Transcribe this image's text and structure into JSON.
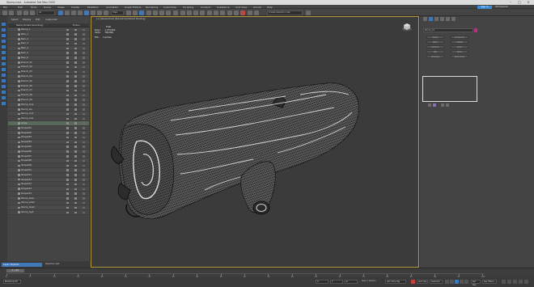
{
  "window": {
    "title": "Stump.max - Autodesk 3ds Max 2020"
  },
  "menu": [
    "File",
    "Edit",
    "Tools",
    "Group",
    "Views",
    "Create",
    "Modifiers",
    "Animation",
    "Graph Editors",
    "Rendering",
    "Customize",
    "Scripting",
    "Content",
    "Substance",
    "Civil View",
    "Arnold",
    "Help"
  ],
  "signin": "Sign In",
  "workspace": "Workspaces:",
  "toolbar": {
    "selection_set": "Create Selection Set",
    "view": "View"
  },
  "left_tabs": [
    "Select",
    "Display",
    "Edit",
    "Customize"
  ],
  "scene_header": {
    "col1": "Name (Sorted Ascending)",
    "col2": "Frozen"
  },
  "scene_rows": [
    "Stump_1",
    "Bark_1",
    "Bark_2",
    "Bark_3",
    "Bark_4",
    "Bark_5",
    "Bark_6",
    "Branch_01",
    "Branch_02",
    "Branch_03",
    "Branch_04",
    "Branch_05",
    "Branch_06",
    "Branch_07",
    "Branch_08",
    "Branch_09",
    "Stump_hole",
    "Stump_top",
    "Stump_root",
    "Stump_side",
    "Group",
    "Shape001",
    "Shape002",
    "Shape003",
    "Shape004",
    "Shape005",
    "Shape006",
    "Shape007",
    "Shape008",
    "Shape009",
    "Shape010",
    "Shape011",
    "Shape012",
    "Shape013",
    "Shape014",
    "Shape015",
    "Stump_base",
    "Stump_side2",
    "Stump_mesh",
    "Stump_high"
  ],
  "viewport": {
    "label": "[+] [Perspective] [Standard] [Default Shading]",
    "stats": {
      "title": "Total",
      "polys_label": "Polys:",
      "polys_value": "1,374,504",
      "verts_label": "Verts:",
      "verts_value": "700,864",
      "fps_label": "FPS:",
      "fps_value": "Inactive"
    }
  },
  "right_panel": {
    "object_name": "Stump_01",
    "buttons": [
      "Shape",
      "Compound",
      "Patch",
      "NURBS",
      "Particles",
      "Doors",
      "AEC",
      "Stairs",
      "Windows",
      "Point Cloud"
    ]
  },
  "status": {
    "layer": "Layer: Explorer",
    "selection": "Selection Set:"
  },
  "timeline": {
    "frame": "0 / 100",
    "ticks": [
      "0",
      "5",
      "10",
      "15",
      "20",
      "25",
      "30",
      "35",
      "40",
      "45",
      "50",
      "55",
      "60",
      "65",
      "70",
      "75",
      "80",
      "85",
      "90",
      "95",
      "100"
    ]
  },
  "bottom": {
    "script": "MAXScript Mi",
    "x": "X:",
    "y": "Y:",
    "z": "Z:",
    "grid": "Grid = 10.0cm",
    "addtime": "Add Time Tag",
    "autokey": "Auto Key",
    "selected": "Selected",
    "setkey": "Set Key",
    "keyfilters": "Key Filters..."
  }
}
